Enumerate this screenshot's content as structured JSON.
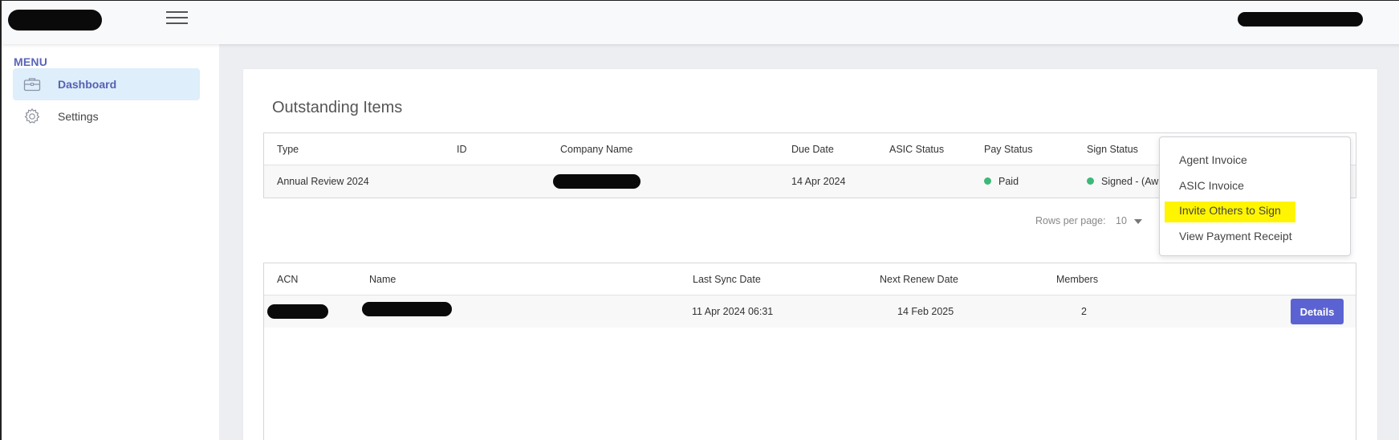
{
  "header": {
    "logo_icon": "redacted-logo",
    "menu_icon": "hamburger-icon",
    "user_icon": "redacted-user"
  },
  "sidebar": {
    "heading": "MENU",
    "items": [
      {
        "label": "Dashboard",
        "icon": "briefcase-icon",
        "active": true
      },
      {
        "label": "Settings",
        "icon": "gear-icon",
        "active": false
      }
    ]
  },
  "outstanding": {
    "title": "Outstanding Items",
    "columns": [
      "Type",
      "ID",
      "Company Name",
      "Due Date",
      "ASIC Status",
      "Pay Status",
      "Sign Status"
    ],
    "rows": [
      {
        "type": "Annual Review 2024",
        "id": "",
        "company_name": "",
        "due_date": "14 Apr 2024",
        "asic_status": "",
        "pay_status": "Paid",
        "sign_status": "Signed - (Awa"
      }
    ],
    "status_color": "#3cb878",
    "rows_per_page_label": "Rows per page:",
    "rows_per_page_value": "10"
  },
  "action_menu": {
    "items": [
      {
        "label": "Agent Invoice",
        "highlighted": false
      },
      {
        "label": "ASIC Invoice",
        "highlighted": false
      },
      {
        "label": "Invite Others to Sign",
        "highlighted": true
      },
      {
        "label": "View Payment Receipt",
        "highlighted": false
      }
    ],
    "highlight_color": "#fff500"
  },
  "companies": {
    "columns": [
      "ACN",
      "Name",
      "Last Sync Date",
      "Next Renew Date",
      "Members"
    ],
    "rows": [
      {
        "acn": "",
        "name": "",
        "last_sync_date": "11 Apr 2024 06:31",
        "next_renew_date": "14 Feb 2025",
        "members": "2",
        "action_label": "Details"
      }
    ]
  },
  "colors": {
    "accent": "#5b63d3",
    "sidebar_active_bg": "#deeefb",
    "menu_heading": "#5965b8"
  }
}
